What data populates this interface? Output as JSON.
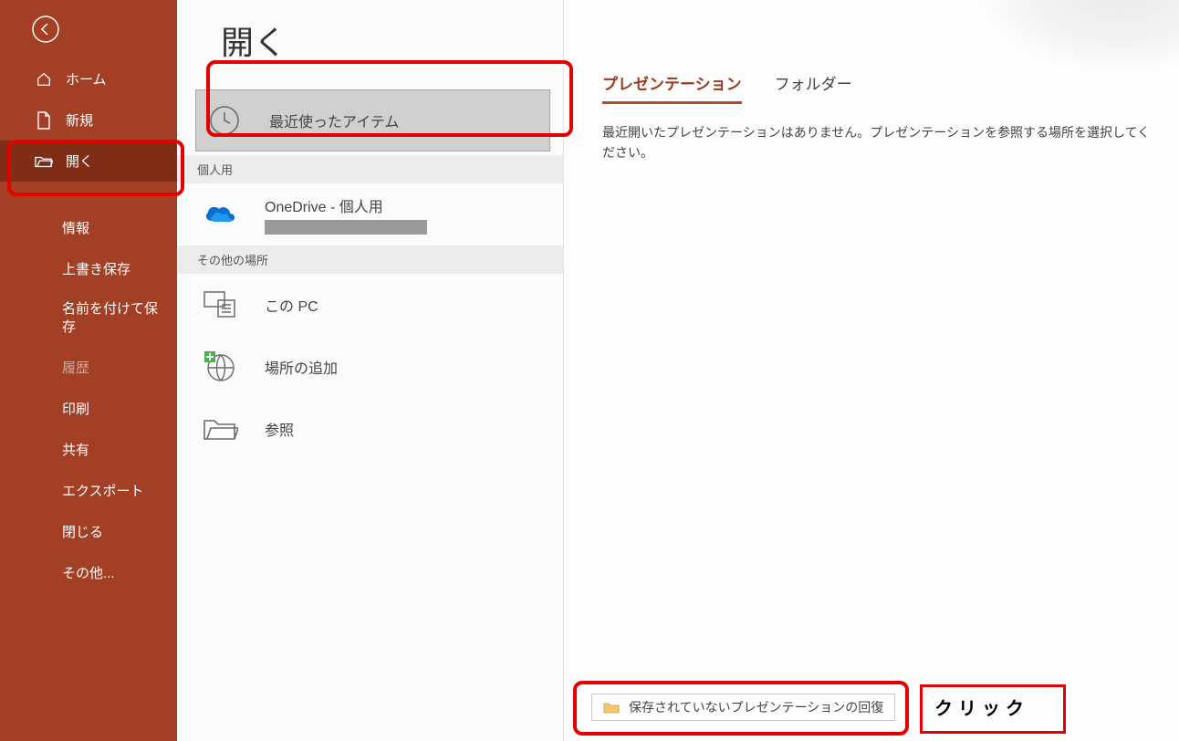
{
  "sidebar": {
    "items": [
      {
        "label": "ホーム",
        "icon": "home"
      },
      {
        "label": "新規",
        "icon": "new-doc"
      },
      {
        "label": "開く",
        "icon": "folder-open",
        "active": true
      },
      {
        "label": "情報",
        "indent": true
      },
      {
        "label": "上書き保存",
        "indent": true
      },
      {
        "label": "名前を付けて保存",
        "indent": true
      },
      {
        "label": "履歴",
        "indent": true,
        "disabled": true
      },
      {
        "label": "印刷",
        "indent": true
      },
      {
        "label": "共有",
        "indent": true
      },
      {
        "label": "エクスポート",
        "indent": true
      },
      {
        "label": "閉じる",
        "indent": true
      },
      {
        "label": "その他...",
        "indent": true
      }
    ]
  },
  "page": {
    "title": "開く"
  },
  "sources": {
    "recent_label": "最近使ったアイテム",
    "personal_header": "個人用",
    "onedrive_label": "OneDrive - 個人用",
    "other_header": "その他の場所",
    "thispc_label": "この PC",
    "addplace_label": "場所の追加",
    "browse_label": "参照"
  },
  "main": {
    "tabs": {
      "presentations": "プレゼンテーション",
      "folders": "フォルダー"
    },
    "empty_msg": "最近開いたプレゼンテーションはありません。プレゼンテーションを参照する場所を選択してください。"
  },
  "recover": {
    "label": "保存されていないプレゼンテーションの回復"
  },
  "annotation": {
    "click": "クリック"
  }
}
